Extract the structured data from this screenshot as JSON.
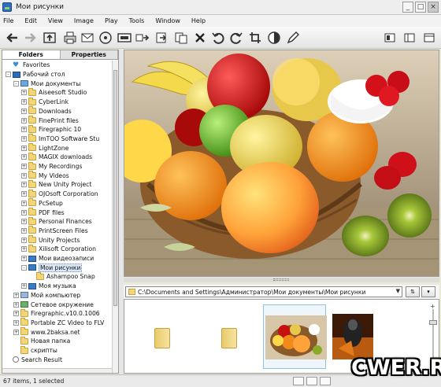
{
  "window": {
    "title": "Мои рисунки"
  },
  "menu": [
    "File",
    "Edit",
    "View",
    "Image",
    "Play",
    "Tools",
    "Window",
    "Help"
  ],
  "toolbar": [
    {
      "name": "back-arrow-icon"
    },
    {
      "name": "forward-arrow-icon"
    },
    {
      "name": "up-folder-icon"
    },
    {
      "name": "print-icon"
    },
    {
      "name": "email-icon"
    },
    {
      "name": "cd-burn-icon"
    },
    {
      "name": "film-strip-icon"
    },
    {
      "name": "convert-icon"
    },
    {
      "name": "copy-to-folder-icon"
    },
    {
      "name": "move-to-folder-icon"
    },
    {
      "name": "delete-icon"
    },
    {
      "name": "rotate-left-icon"
    },
    {
      "name": "rotate-right-icon"
    },
    {
      "name": "crop-icon"
    },
    {
      "name": "adjust-contrast-icon"
    },
    {
      "name": "pen-edit-icon"
    }
  ],
  "left_tabs": [
    "Folders",
    "Properties"
  ],
  "tree": [
    {
      "label": "Favorites",
      "depth": 0,
      "icon": "heart",
      "exp": ""
    },
    {
      "label": "Рабочий стол",
      "depth": 0,
      "icon": "desktop",
      "exp": "-"
    },
    {
      "label": "Мои документы",
      "depth": 1,
      "icon": "docs",
      "exp": "-"
    },
    {
      "label": "Aiseesoft Studio",
      "depth": 2,
      "icon": "folder",
      "exp": "+"
    },
    {
      "label": "CyberLink",
      "depth": 2,
      "icon": "folder",
      "exp": "+"
    },
    {
      "label": "Downloads",
      "depth": 2,
      "icon": "folder",
      "exp": "+"
    },
    {
      "label": "FinePrint files",
      "depth": 2,
      "icon": "folder",
      "exp": "+"
    },
    {
      "label": "Firegraphic 10",
      "depth": 2,
      "icon": "folder",
      "exp": "+"
    },
    {
      "label": "ImTOO Software Stu",
      "depth": 2,
      "icon": "folder",
      "exp": "+"
    },
    {
      "label": "LightZone",
      "depth": 2,
      "icon": "folder",
      "exp": "+"
    },
    {
      "label": "MAGIX downloads",
      "depth": 2,
      "icon": "folder",
      "exp": "+"
    },
    {
      "label": "My Recordings",
      "depth": 2,
      "icon": "folder",
      "exp": "+"
    },
    {
      "label": "My Videos",
      "depth": 2,
      "icon": "folder",
      "exp": "+"
    },
    {
      "label": "New Unity Project",
      "depth": 2,
      "icon": "folder",
      "exp": "+"
    },
    {
      "label": "OJOsoft Corporation",
      "depth": 2,
      "icon": "folder",
      "exp": "+"
    },
    {
      "label": "PcSetup",
      "depth": 2,
      "icon": "folder",
      "exp": "+"
    },
    {
      "label": "PDF files",
      "depth": 2,
      "icon": "folder",
      "exp": "+"
    },
    {
      "label": "Personal Finances",
      "depth": 2,
      "icon": "folder",
      "exp": "+"
    },
    {
      "label": "PrintScreen Files",
      "depth": 2,
      "icon": "folder",
      "exp": "+"
    },
    {
      "label": "Unity Projects",
      "depth": 2,
      "icon": "folder",
      "exp": "+"
    },
    {
      "label": "Xilisoft Corporation",
      "depth": 2,
      "icon": "folder",
      "exp": "+"
    },
    {
      "label": "Мои видеозаписи",
      "depth": 2,
      "icon": "media",
      "exp": "+"
    },
    {
      "label": "Мои рисунки",
      "depth": 2,
      "icon": "media",
      "exp": "-",
      "selected": true
    },
    {
      "label": "Ashampoo Snap",
      "depth": 3,
      "icon": "folder",
      "exp": ""
    },
    {
      "label": "Моя музыка",
      "depth": 2,
      "icon": "media",
      "exp": "+"
    },
    {
      "label": "Мой компьютер",
      "depth": 1,
      "icon": "pc",
      "exp": "+"
    },
    {
      "label": "Сетевое окружение",
      "depth": 1,
      "icon": "net",
      "exp": "+"
    },
    {
      "label": "Firegraphic.v10.0.1006",
      "depth": 1,
      "icon": "folder",
      "exp": "+"
    },
    {
      "label": "Portable ZC Video to FLV",
      "depth": 1,
      "icon": "folder",
      "exp": "+"
    },
    {
      "label": "www.2baksa.net",
      "depth": 1,
      "icon": "folder",
      "exp": "+"
    },
    {
      "label": "Новая папка",
      "depth": 1,
      "icon": "folder",
      "exp": ""
    },
    {
      "label": "скрипты",
      "depth": 1,
      "icon": "folder",
      "exp": ""
    },
    {
      "label": "Search Result",
      "depth": 0,
      "icon": "search",
      "exp": ""
    }
  ],
  "path": {
    "value": "C:\\Documents and Settings\\Администратор\\Мои документы\\Мои рисунки"
  },
  "thumbnails": [
    {
      "kind": "folder"
    },
    {
      "kind": "folder"
    },
    {
      "kind": "fruit-photo",
      "selected": true
    },
    {
      "kind": "game-art"
    }
  ],
  "status": {
    "text": "67 items, 1 selected"
  },
  "watermark": "CWER.RU"
}
